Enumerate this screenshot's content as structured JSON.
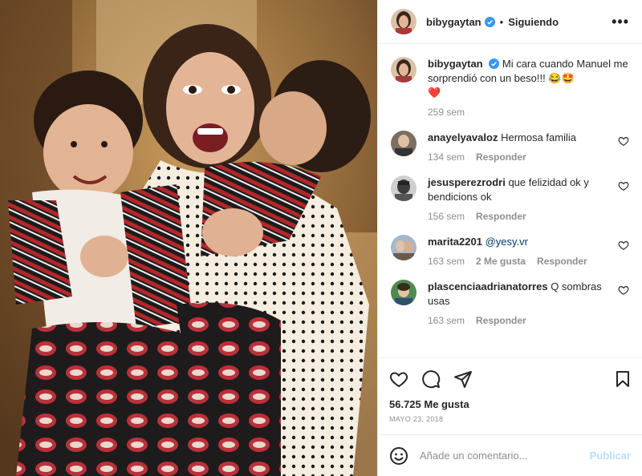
{
  "post": {
    "username": "bibygaytan",
    "follow_status": "Siguiendo",
    "more_label": "•••",
    "caption": "Mi cara cuando Manuel me sorprendió con un beso!!! 😂🤩",
    "caption_heart": "❤️",
    "caption_time": "259 sem"
  },
  "comments": [
    {
      "user": "anayelyavaloz",
      "text": "Hermosa familia",
      "time": "134 sem",
      "reply": "Responder",
      "likes": ""
    },
    {
      "user": "jesusperezrodri",
      "text": "que felizidad ok y bendicions ok",
      "time": "156 sem",
      "reply": "Responder",
      "likes": ""
    },
    {
      "user": "marita2201",
      "mention": "@yesy.vr",
      "text": "",
      "time": "163 sem",
      "likes": "2 Me gusta",
      "reply": "Responder"
    },
    {
      "user": "plascenciaadrianatorres",
      "text": "Q sombras usas",
      "time": "163 sem",
      "reply": "Responder",
      "likes": ""
    }
  ],
  "footer": {
    "likes": "56.725 Me gusta",
    "date": "MAYO 23, 2018",
    "comment_placeholder": "Añade un comentario...",
    "post_button": "Publicar"
  },
  "icons": {
    "verified": "verified-badge-icon",
    "heart": "heart-icon",
    "comment": "comment-icon",
    "share": "share-icon",
    "save": "bookmark-icon",
    "emoji": "emoji-icon"
  },
  "colors": {
    "verified": "#3897f0",
    "link": "#00376b",
    "muted": "#8e8e8e",
    "publish": "#b2dffc",
    "heart_red": "#ed4956"
  }
}
